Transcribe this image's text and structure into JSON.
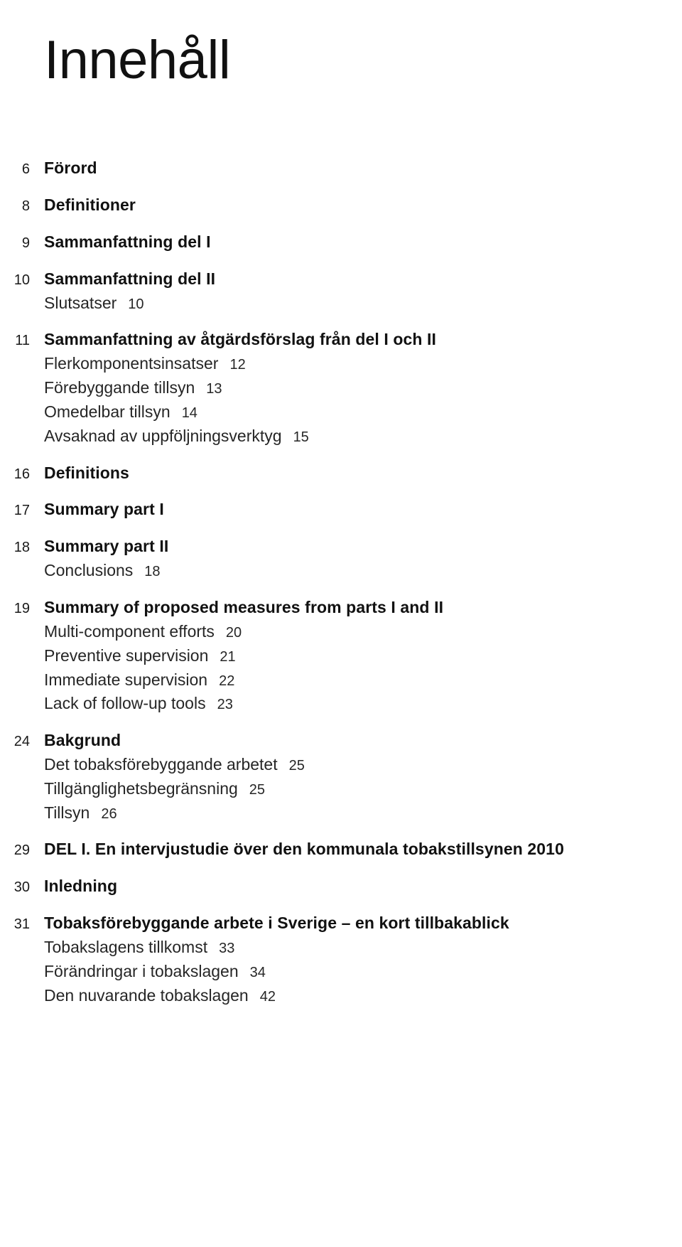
{
  "document": {
    "title": "Innehåll"
  },
  "toc": {
    "groups": [
      {
        "page": "6",
        "label": "Förord",
        "children": []
      },
      {
        "page": "8",
        "label": "Definitioner",
        "children": []
      },
      {
        "page": "9",
        "label": "Sammanfattning del I",
        "children": []
      },
      {
        "page": "10",
        "label": "Sammanfattning del II",
        "children": [
          {
            "label": "Slutsatser",
            "page": "10"
          }
        ]
      },
      {
        "page": "11",
        "label": "Sammanfattning av åtgärdsförslag från del I och II",
        "children": [
          {
            "label": "Flerkomponentsinsatser",
            "page": "12"
          },
          {
            "label": "Förebyggande tillsyn",
            "page": "13"
          },
          {
            "label": "Omedelbar tillsyn",
            "page": "14"
          },
          {
            "label": "Avsaknad av uppföljningsverktyg",
            "page": "15"
          }
        ]
      },
      {
        "page": "16",
        "label": "Definitions",
        "children": []
      },
      {
        "page": "17",
        "label": "Summary part I",
        "children": []
      },
      {
        "page": "18",
        "label": "Summary part II",
        "children": [
          {
            "label": "Conclusions",
            "page": "18"
          }
        ]
      },
      {
        "page": "19",
        "label": "Summary of proposed measures from parts I and II",
        "children": [
          {
            "label": "Multi-component efforts",
            "page": "20"
          },
          {
            "label": "Preventive supervision",
            "page": "21"
          },
          {
            "label": "Immediate supervision",
            "page": "22"
          },
          {
            "label": "Lack of follow-up tools",
            "page": "23"
          }
        ]
      },
      {
        "page": "24",
        "label": "Bakgrund",
        "children": [
          {
            "label": "Det tobaksförebyggande arbetet",
            "page": "25"
          },
          {
            "label": "Tillgänglighetsbegränsning",
            "page": "25"
          },
          {
            "label": "Tillsyn",
            "page": "26"
          }
        ]
      },
      {
        "page": "29",
        "label": "DEL I. En intervjustudie över den kommunala tobakstillsynen 2010",
        "children": []
      },
      {
        "page": "30",
        "label": "Inledning",
        "children": []
      },
      {
        "page": "31",
        "label": "Tobaksförebyggande arbete i Sverige – en kort tillbakablick",
        "children": [
          {
            "label": "Tobakslagens tillkomst",
            "page": "33"
          },
          {
            "label": "Förändringar i tobakslagen",
            "page": "34"
          },
          {
            "label": "Den nuvarande tobakslagen",
            "page": "42"
          }
        ]
      }
    ]
  }
}
